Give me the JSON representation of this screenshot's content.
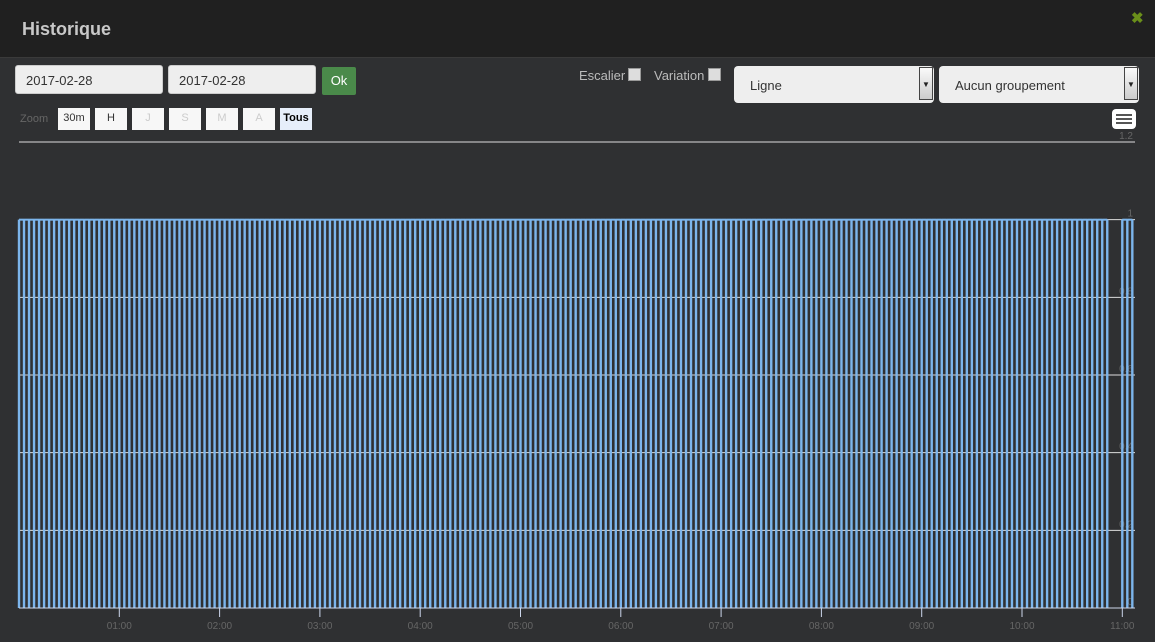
{
  "header": {
    "title": "Historique",
    "close_icon": "close-icon",
    "close_color": "#6a8f1a"
  },
  "toolbar": {
    "start_date": "2017-02-28",
    "end_date": "2017-02-28",
    "ok_label": "Ok",
    "stairs_label": "Escalier",
    "stairs_checked": false,
    "variation_label": "Variation",
    "variation_checked": false,
    "chart_type": "Ligne",
    "grouping": "Aucun groupement"
  },
  "zoom": {
    "label": "Zoom",
    "buttons": [
      {
        "label": "30m",
        "state": "enabled"
      },
      {
        "label": "H",
        "state": "enabled"
      },
      {
        "label": "J",
        "state": "disabled"
      },
      {
        "label": "S",
        "state": "disabled"
      },
      {
        "label": "M",
        "state": "disabled"
      },
      {
        "label": "A",
        "state": "disabled"
      },
      {
        "label": "Tous",
        "state": "active"
      }
    ]
  },
  "chart_data": {
    "type": "line",
    "color": "#7cb5ec",
    "ylim": [
      0,
      1.2
    ],
    "yticks": [
      "0",
      "0.2",
      "0.4",
      "0.6",
      "0.8",
      "1",
      "1.2"
    ],
    "xticks": [
      "01:00",
      "02:00",
      "03:00",
      "04:00",
      "05:00",
      "06:00",
      "07:00",
      "08:00",
      "09:00",
      "10:00",
      "11:00"
    ],
    "xlim": [
      "00:00",
      "11:07"
    ],
    "grid": true,
    "legend": "none",
    "series": [
      {
        "y_on": 1,
        "y_off": 0,
        "x": [
          "00:00",
          "00:03",
          "00:06",
          "00:09",
          "00:12",
          "00:15",
          "00:18",
          "00:21",
          "00:24",
          "00:27",
          "00:30",
          "00:33",
          "00:36",
          "00:39",
          "00:42",
          "00:45",
          "00:48",
          "00:51",
          "00:54",
          "00:57",
          "01:00",
          "01:03",
          "01:06",
          "01:09",
          "01:12",
          "01:15",
          "01:18",
          "01:21",
          "01:24",
          "01:27",
          "01:30",
          "01:33",
          "01:36",
          "01:39",
          "01:42",
          "01:45",
          "01:48",
          "01:51",
          "01:54",
          "01:57",
          "02:00",
          "02:03",
          "02:06",
          "02:09",
          "02:12",
          "02:15",
          "02:18",
          "02:21",
          "02:24",
          "02:27",
          "02:30",
          "02:33",
          "02:36",
          "02:39",
          "02:42",
          "02:45",
          "02:48",
          "02:51",
          "02:54",
          "02:57",
          "03:00",
          "03:03",
          "03:06",
          "03:09",
          "03:12",
          "03:15",
          "03:18",
          "03:21",
          "03:24",
          "03:27",
          "03:30",
          "03:33",
          "03:36",
          "03:39",
          "03:42",
          "03:45",
          "03:48",
          "03:51",
          "03:54",
          "03:57",
          "04:00",
          "04:03",
          "04:06",
          "04:09",
          "04:12",
          "04:15",
          "04:18",
          "04:21",
          "04:24",
          "04:27",
          "04:30",
          "04:33",
          "04:36",
          "04:39",
          "04:42",
          "04:45",
          "04:48",
          "04:51",
          "04:54",
          "04:57",
          "05:00",
          "05:03",
          "05:06",
          "05:09",
          "05:12",
          "05:15",
          "05:18",
          "05:21",
          "05:24",
          "05:27",
          "05:30",
          "05:33",
          "05:36",
          "05:39",
          "05:42",
          "05:45",
          "05:48",
          "05:51",
          "05:54",
          "05:57",
          "06:00",
          "06:03",
          "06:06",
          "06:09",
          "06:12",
          "06:15",
          "06:18",
          "06:21",
          "06:24",
          "06:27",
          "06:30",
          "06:33",
          "06:36",
          "06:39",
          "06:42",
          "06:45",
          "06:48",
          "06:51",
          "06:54",
          "06:57",
          "07:00",
          "07:03",
          "07:06",
          "07:09",
          "07:12",
          "07:15",
          "07:18",
          "07:21",
          "07:24",
          "07:27",
          "07:30",
          "07:33",
          "07:36",
          "07:39",
          "07:42",
          "07:45",
          "07:48",
          "07:51",
          "07:54",
          "07:57",
          "08:00",
          "08:03",
          "08:06",
          "08:09",
          "08:12",
          "08:15",
          "08:18",
          "08:21",
          "08:24",
          "08:27",
          "08:30",
          "08:33",
          "08:36",
          "08:39",
          "08:42",
          "08:45",
          "08:48",
          "08:51",
          "08:54",
          "08:57",
          "09:00",
          "09:03",
          "09:06",
          "09:09",
          "09:12",
          "09:15",
          "09:18",
          "09:21",
          "09:24",
          "09:27",
          "09:30",
          "09:33",
          "09:36",
          "09:39",
          "09:42",
          "09:45",
          "09:48",
          "09:51",
          "09:54",
          "09:57",
          "10:00",
          "10:03",
          "10:06",
          "10:09",
          "10:12",
          "10:15",
          "10:18",
          "10:21",
          "10:24",
          "10:27",
          "10:30",
          "10:33",
          "10:36",
          "10:39",
          "10:42",
          "10:45",
          "10:48",
          "10:51",
          "11:00",
          "11:03",
          "11:06"
        ]
      }
    ]
  }
}
